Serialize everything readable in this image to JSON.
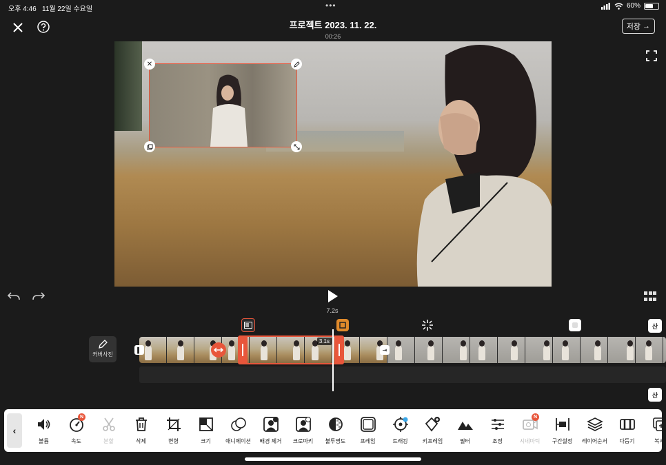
{
  "status_bar": {
    "time": "오후 4:46",
    "date": "11월 22일 수요일",
    "battery": "60%",
    "battery_level": 0.6
  },
  "header": {
    "title": "프로젝트 2023. 11. 22.",
    "duration": "00:26",
    "save_label": "저장",
    "save_arrow": "→"
  },
  "playback": {
    "current_time": "7.2s"
  },
  "timeline": {
    "cover_label": "커버사진",
    "clip_duration": "3.1s",
    "end_label_top": "산",
    "end_label_bottom": "산"
  },
  "toolbar": {
    "back_label": "‹",
    "tools": [
      {
        "label": "볼륨",
        "icon": "volume-icon",
        "disabled": false,
        "badge": ""
      },
      {
        "label": "속도",
        "icon": "speed-icon",
        "disabled": false,
        "badge": "N"
      },
      {
        "label": "분할",
        "icon": "scissors-icon",
        "disabled": true,
        "badge": ""
      },
      {
        "label": "삭제",
        "icon": "trash-icon",
        "disabled": false,
        "badge": ""
      },
      {
        "label": "변형",
        "icon": "crop-icon",
        "disabled": false,
        "badge": ""
      },
      {
        "label": "크기",
        "icon": "resize-icon",
        "disabled": false,
        "badge": ""
      },
      {
        "label": "애니메이션",
        "icon": "animation-icon",
        "disabled": false,
        "badge": ""
      },
      {
        "label": "배경 제거",
        "icon": "background-remove-icon",
        "disabled": false,
        "badge": ""
      },
      {
        "label": "크로마키",
        "icon": "chroma-key-icon",
        "disabled": false,
        "badge": ""
      },
      {
        "label": "불투명도",
        "icon": "opacity-icon",
        "disabled": false,
        "badge": ""
      },
      {
        "label": "프레임",
        "icon": "frame-icon",
        "disabled": false,
        "badge": ""
      },
      {
        "label": "트래킹",
        "icon": "tracking-icon",
        "disabled": false,
        "badge": ""
      },
      {
        "label": "키프레임",
        "icon": "keyframe-icon",
        "disabled": false,
        "badge": ""
      },
      {
        "label": "필터",
        "icon": "filter-icon",
        "disabled": false,
        "badge": ""
      },
      {
        "label": "조정",
        "icon": "adjust-icon",
        "disabled": false,
        "badge": ""
      },
      {
        "label": "시네마틱",
        "icon": "cinematic-icon",
        "disabled": true,
        "badge": "N"
      },
      {
        "label": "구간설정",
        "icon": "range-icon",
        "disabled": false,
        "badge": ""
      },
      {
        "label": "레이어순서",
        "icon": "layers-icon",
        "disabled": false,
        "badge": ""
      },
      {
        "label": "다듬기",
        "icon": "trim-icon",
        "disabled": false,
        "badge": ""
      },
      {
        "label": "복사",
        "icon": "copy-icon",
        "disabled": false,
        "badge": ""
      }
    ]
  },
  "colors": {
    "accent": "#e8563b",
    "background": "#1b1b1b"
  }
}
